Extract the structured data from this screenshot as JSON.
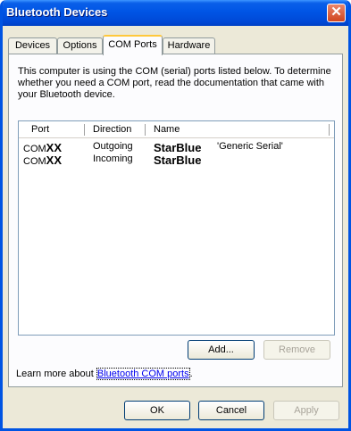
{
  "window": {
    "title": "Bluetooth Devices",
    "close_label": "✕"
  },
  "tabs": [
    {
      "label": "Devices"
    },
    {
      "label": "Options"
    },
    {
      "label": "COM Ports",
      "active": true
    },
    {
      "label": "Hardware"
    }
  ],
  "description": "This computer is using the COM (serial) ports listed below. To determine whether you need a COM port, read the documentation that came with your Bluetooth device.",
  "table": {
    "columns": [
      "Port",
      "Direction",
      "Name"
    ],
    "rows": [
      {
        "port_prefix": "COM",
        "port_suffix": "XX",
        "direction": "Outgoing",
        "device": "StarBlue",
        "service": "'Generic Serial'"
      },
      {
        "port_prefix": "COM",
        "port_suffix": "XX",
        "direction": "Incoming",
        "device": "StarBlue",
        "service": ""
      }
    ]
  },
  "buttons": {
    "add": "Add...",
    "remove": "Remove",
    "ok": "OK",
    "cancel": "Cancel",
    "apply": "Apply"
  },
  "learn_more": {
    "prefix": "Learn more about ",
    "link": "Bluetooth COM ports",
    "suffix": "."
  }
}
